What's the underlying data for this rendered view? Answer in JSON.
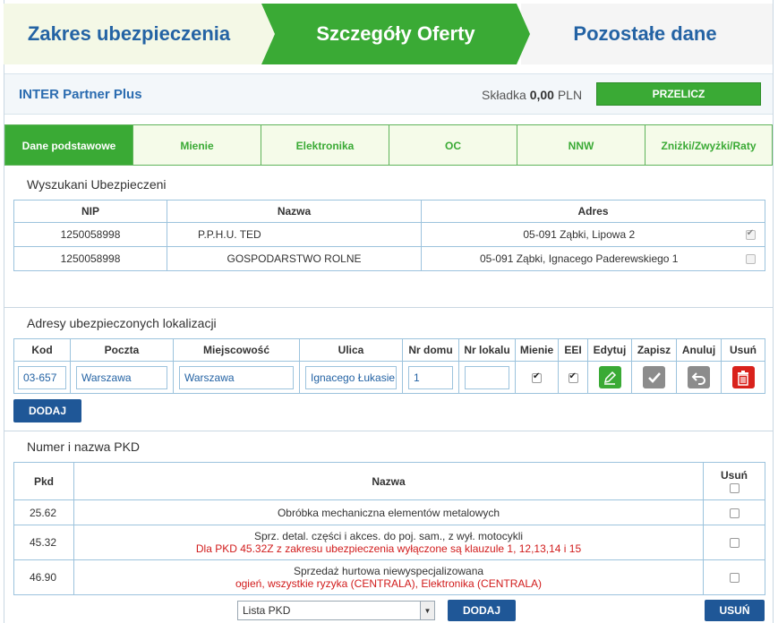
{
  "wizard": {
    "steps": [
      "Zakres ubezpieczenia",
      "Szczegóły Oferty",
      "Pozostałe dane"
    ]
  },
  "product": {
    "name": "INTER Partner Plus",
    "premium_label": "Składka",
    "premium_value": "0,00",
    "premium_currency": "PLN",
    "recalc_button": "PRZELICZ"
  },
  "tabs": [
    "Dane podstawowe",
    "Mienie",
    "Elektronika",
    "OC",
    "NNW",
    "Zniżki/Zwyżki/Raty"
  ],
  "insured": {
    "title": "Wyszukani Ubezpieczeni",
    "headers": [
      "NIP",
      "Nazwa",
      "Adres"
    ],
    "rows": [
      {
        "nip": "1250058998",
        "name": "P.P.H.U. TED",
        "address": "05-091 Ząbki, Lipowa 2",
        "checked": true
      },
      {
        "nip": "1250058998",
        "name": "GOSPODARSTWO ROLNE",
        "address": "05-091 Ząbki, Ignacego Paderewskiego 1",
        "checked": false
      }
    ]
  },
  "locations": {
    "title": "Adresy ubezpieczonych lokalizacji",
    "headers": [
      "Kod",
      "Poczta",
      "Miejscowość",
      "Ulica",
      "Nr domu",
      "Nr lokalu",
      "Mienie",
      "EEI",
      "Edytuj",
      "Zapisz",
      "Anuluj",
      "Usuń"
    ],
    "row": {
      "kod": "03-657",
      "poczta": "Warszawa",
      "miejscowosc": "Warszawa",
      "ulica": "Ignacego Łukasie",
      "nr_domu": "1",
      "nr_lokalu": "",
      "mienie": true,
      "eei": true
    },
    "add_button": "DODAJ"
  },
  "pkd": {
    "title": "Numer i nazwa PKD",
    "headers": [
      "Pkd",
      "Nazwa",
      "Usuń"
    ],
    "rows": [
      {
        "code": "25.62",
        "name": "Obróbka mechaniczna elementów metalowych",
        "note": ""
      },
      {
        "code": "45.32",
        "name": "Sprz. detal. części i akces. do poj. sam., z wył. motocykli",
        "note": "Dla PKD 45.32Z z zakresu ubezpieczenia wyłączone są klauzule 1, 12,13,14 i 15"
      },
      {
        "code": "46.90",
        "name": "Sprzedaż hurtowa niewyspecjalizowana",
        "note": "ogień, wszystkie ryzyka (CENTRALA), Elektronika (CENTRALA)"
      }
    ],
    "select_value": "Lista PKD",
    "add_button": "DODAJ",
    "remove_button": "USUŃ"
  },
  "colors": {
    "accent_green": "#3aaa35",
    "primary_blue": "#1f5797",
    "title_blue": "#2463a4",
    "warning_red": "#d11b1b"
  }
}
